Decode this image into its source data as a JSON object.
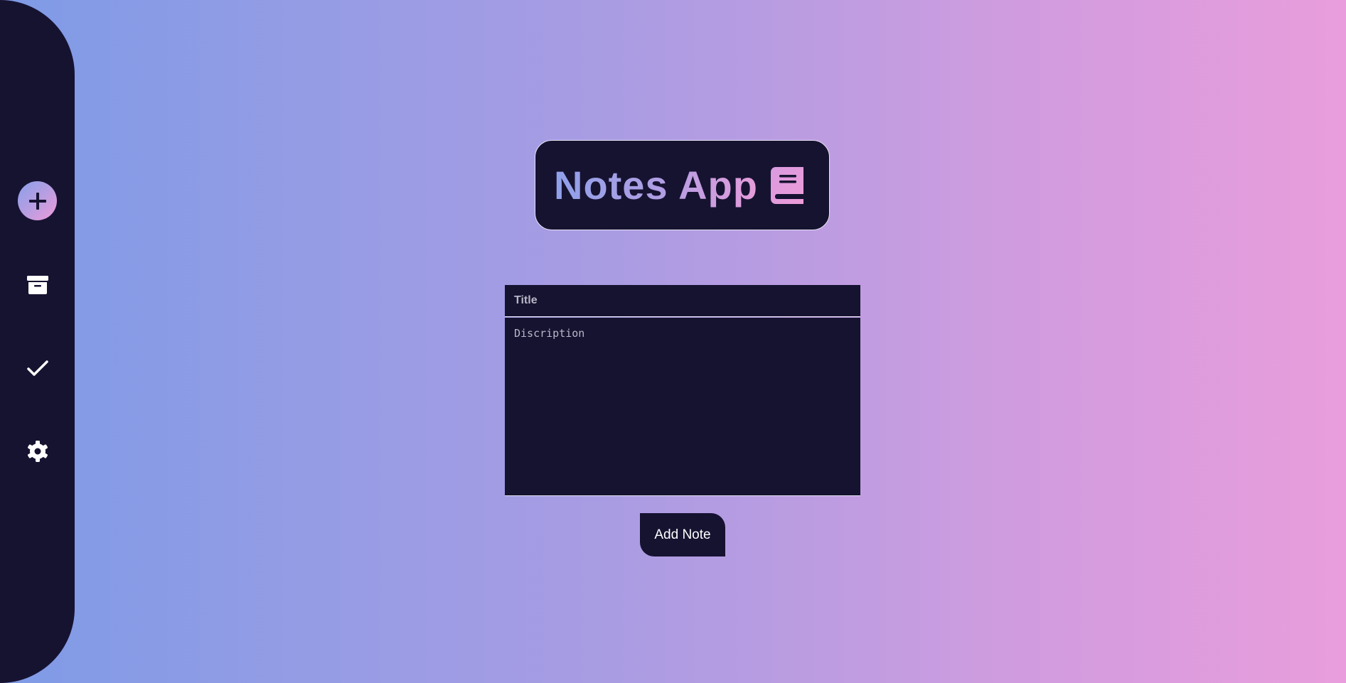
{
  "sidebar": {
    "items": [
      {
        "name": "add",
        "icon": "plus-icon"
      },
      {
        "name": "archive",
        "icon": "archive-box-icon"
      },
      {
        "name": "completed",
        "icon": "checkmark-icon"
      },
      {
        "name": "settings",
        "icon": "gear-icon"
      }
    ]
  },
  "header": {
    "title": "Notes App",
    "icon": "book-icon"
  },
  "form": {
    "title_placeholder": "Title",
    "title_value": "",
    "description_placeholder": "Discription",
    "description_value": "",
    "submit_label": "Add Note"
  },
  "colors": {
    "dark": "#161331",
    "gradient_start": "#7f9be6",
    "gradient_end": "#e99ddc"
  }
}
